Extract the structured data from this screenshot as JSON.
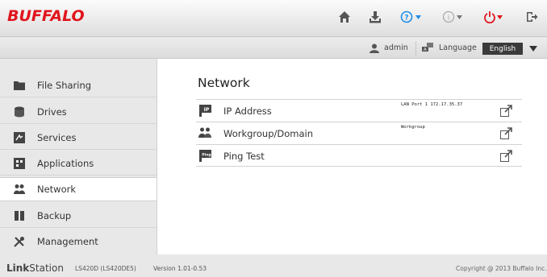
{
  "header": {
    "logo": "BUFFALO",
    "colors": {
      "brand": "#e0141c",
      "help": "#1e8ee8",
      "power": "#e0141c",
      "icon": "#555555"
    },
    "icons": [
      "home-icon",
      "download-icon",
      "help-icon",
      "info-icon",
      "power-icon",
      "logout-icon"
    ]
  },
  "subbar": {
    "user": "admin",
    "language_label": "Language",
    "language_value": "English"
  },
  "sidebar": {
    "items": [
      {
        "label": "File Sharing",
        "icon": "folder-icon"
      },
      {
        "label": "Drives",
        "icon": "drive-icon"
      },
      {
        "label": "Services",
        "icon": "services-icon"
      },
      {
        "label": "Applications",
        "icon": "applications-icon"
      },
      {
        "label": "Network",
        "icon": "network-icon",
        "active": true
      },
      {
        "label": "Backup",
        "icon": "backup-icon"
      },
      {
        "label": "Management",
        "icon": "management-icon"
      }
    ]
  },
  "main": {
    "title": "Network",
    "rows": [
      {
        "label": "IP Address",
        "value": "LAN Port 1 172.17.35.37",
        "icon": "ip-icon"
      },
      {
        "label": "Workgroup/Domain",
        "value": "Workgroup",
        "icon": "workgroup-icon"
      },
      {
        "label": "Ping Test",
        "value": "",
        "icon": "ping-icon"
      }
    ]
  },
  "footer": {
    "brand_bold": "Link",
    "brand_rest": "Station",
    "model": "LS420D (LS420DE5)",
    "version": "Version 1.01-0.53",
    "copyright": "Copyright @ 2013 Buffalo Inc."
  }
}
